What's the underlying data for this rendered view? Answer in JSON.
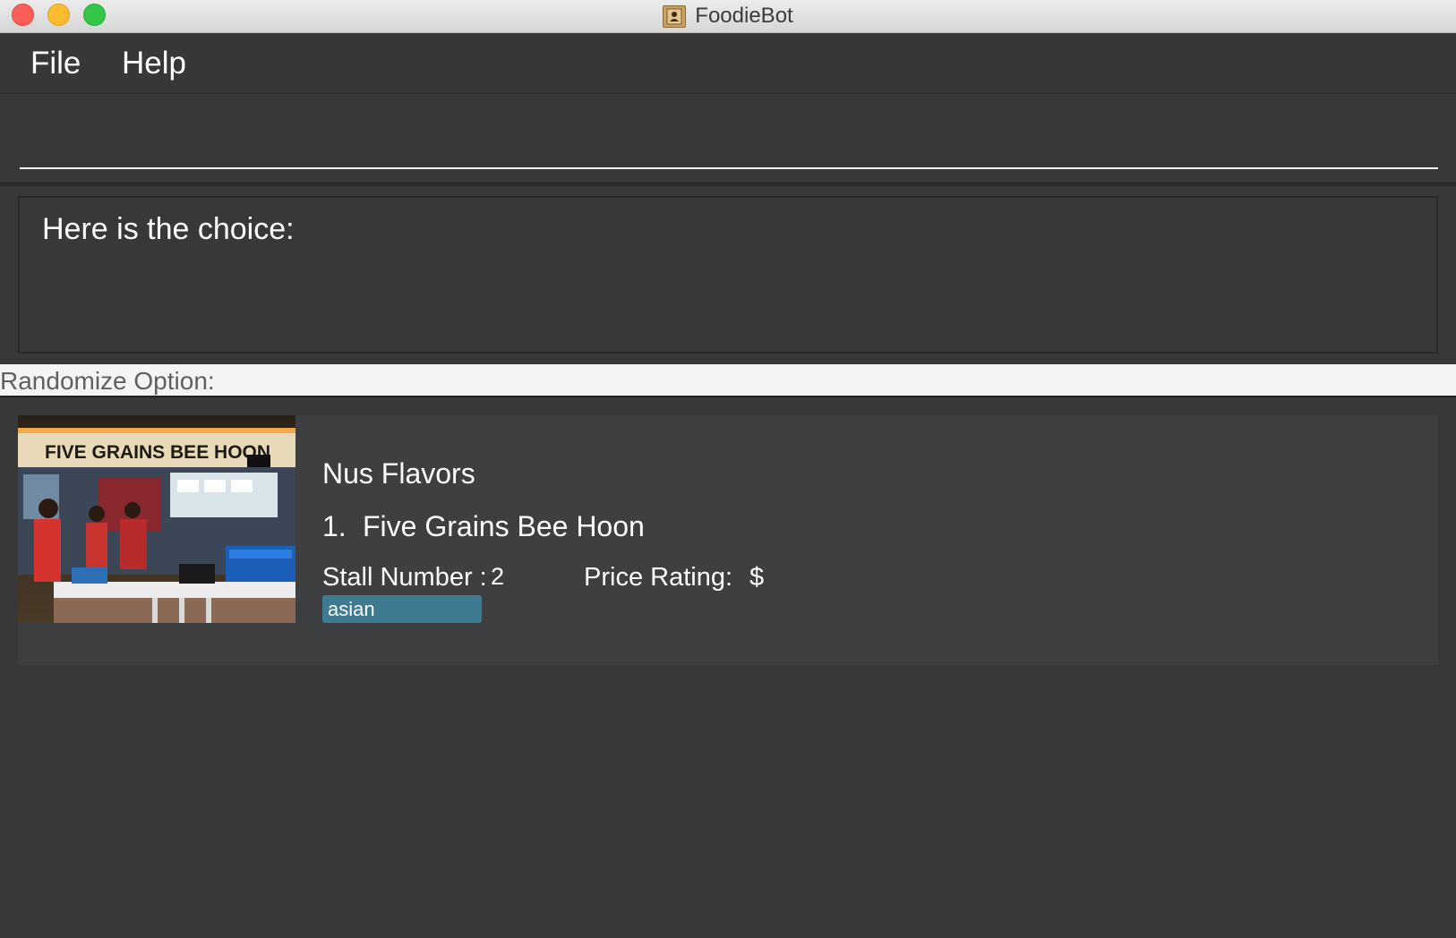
{
  "window": {
    "title": "FoodieBot",
    "app_icon": "contacts-book-icon"
  },
  "menu": {
    "file_label": "File",
    "help_label": "Help"
  },
  "command_box": {
    "value": "",
    "placeholder": ""
  },
  "result_display": {
    "text": "Here is the choice:"
  },
  "randomize_panel": {
    "header": "Randomize Option:"
  },
  "food_card": {
    "canteen": "Nus Flavors",
    "index": "1.",
    "stall_name": "Five Grains Bee Hoon",
    "stall_number_label": "Stall Number :",
    "stall_number": "2",
    "price_rating_label": "Price Rating:",
    "price_rating": "$",
    "tags": [
      "asian"
    ],
    "photo_sign_text": "FIVE GRAINS BEE HOON"
  },
  "colors": {
    "background": "#383838",
    "tag": "#3e7b91",
    "header_strip": "#f4f4f4"
  }
}
